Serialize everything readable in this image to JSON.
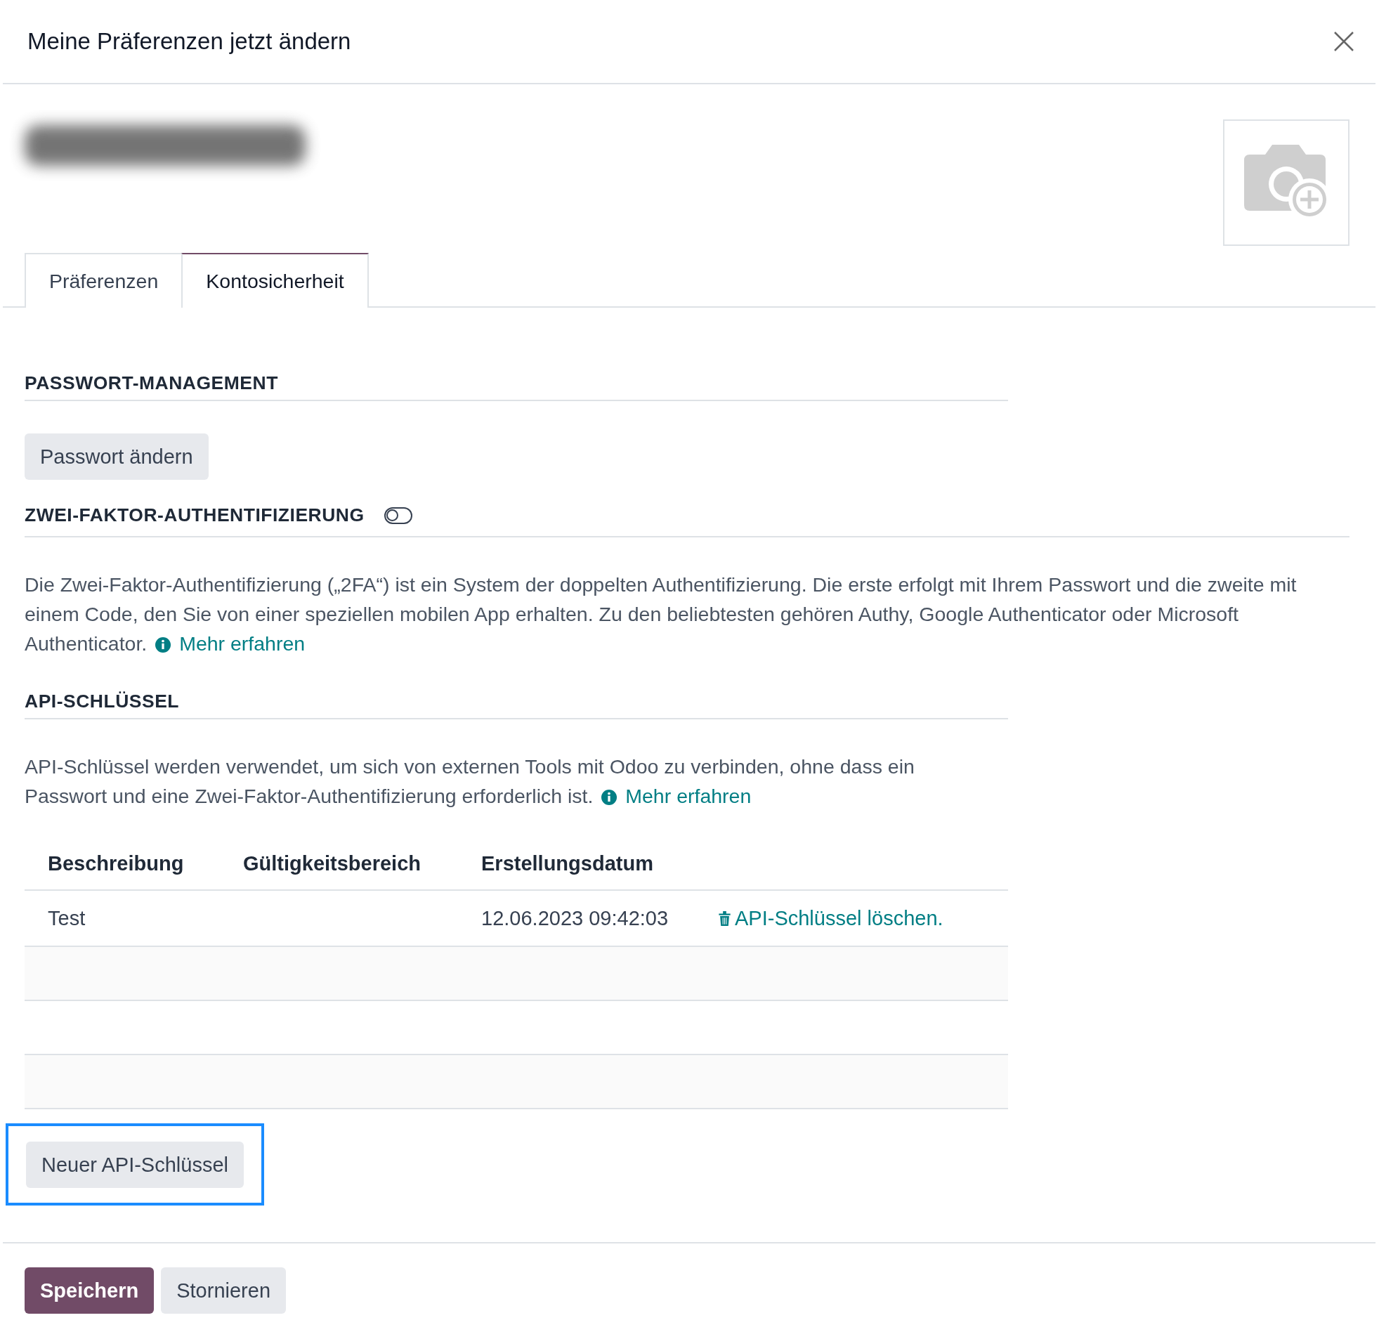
{
  "dialog": {
    "title": "Meine Präferenzen jetzt ändern"
  },
  "tabs": [
    {
      "label": "Präferenzen",
      "selected": false
    },
    {
      "label": "Kontosicherheit",
      "selected": true
    }
  ],
  "password_section": {
    "heading": "PASSWORT-MANAGEMENT",
    "button": "Passwort ändern"
  },
  "two_factor": {
    "heading": "ZWEI-FAKTOR-AUTHENTIFIZIERUNG",
    "on": false,
    "text": "Die Zwei-Faktor-Authentifizierung („2FA“) ist ein System der doppelten Authentifizierung. Die erste erfolgt mit Ihrem Passwort und die zweite mit einem Code, den Sie von einer speziellen mobilen App erhalten. Zu den beliebtesten gehören Authy, Google Authenticator oder Microsoft Authenticator.",
    "link": "Mehr erfahren"
  },
  "api_keys": {
    "heading": "API-SCHLÜSSEL",
    "text": "API-Schlüssel werden verwendet, um sich von externen Tools mit Odoo zu verbinden, ohne dass ein Passwort und eine Zwei-Faktor-Authentifizierung erforderlich ist.",
    "link": "Mehr erfahren",
    "columns": [
      "Beschreibung",
      "Gültigkeitsbereich",
      "Erstellungsdatum"
    ],
    "rows": [
      {
        "description": "Test",
        "created": "12.06.2023 09:42:03",
        "action": "API-Schlüssel löschen."
      }
    ],
    "new_button": {
      "label": "Neuer API-Schlüssel",
      "highlighted": true
    }
  },
  "footer": {
    "buttons": [
      {
        "label": "Speichern",
        "kind": "primary"
      },
      {
        "label": "Stornieren",
        "kind": "secondary"
      }
    ]
  }
}
